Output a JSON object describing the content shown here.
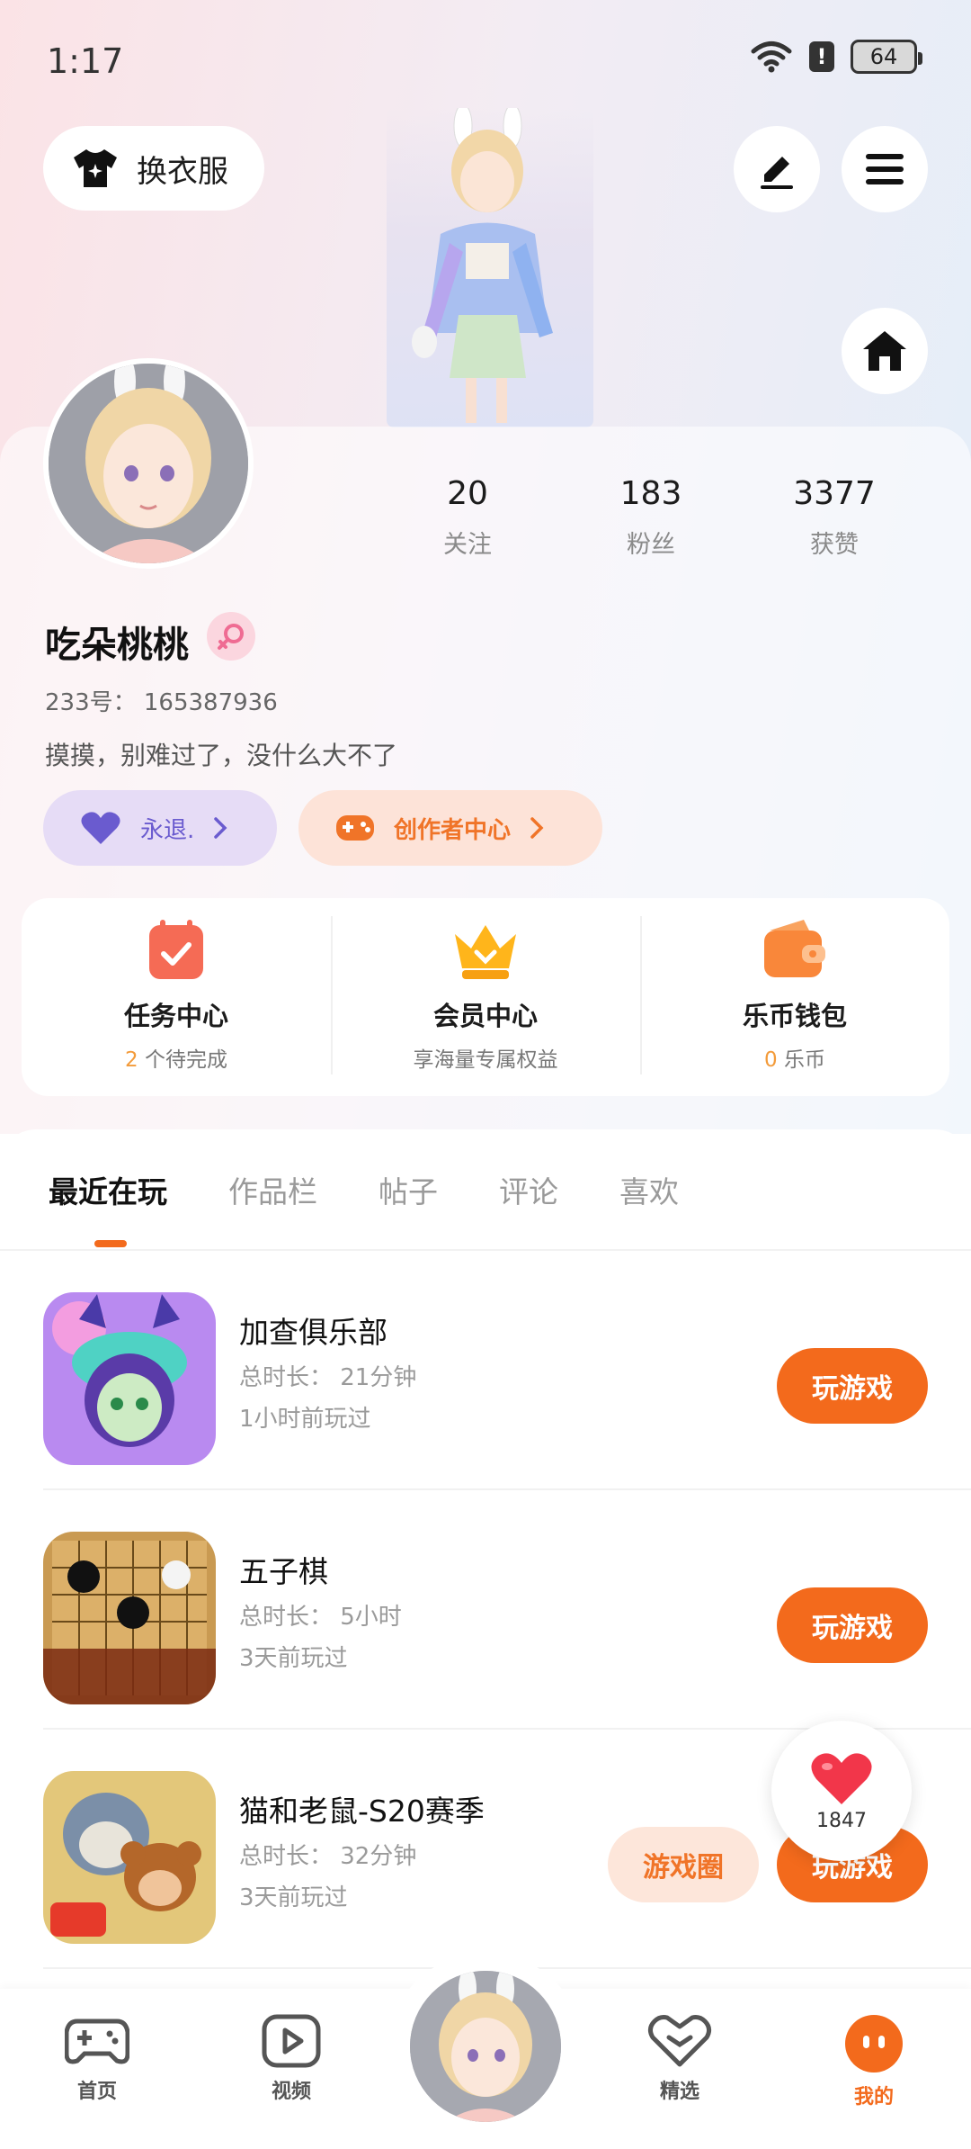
{
  "status_bar": {
    "time": "1:17",
    "battery": "64"
  },
  "header": {
    "outfit_label": "换衣服"
  },
  "profile": {
    "stats": [
      {
        "value": "20",
        "label": "关注"
      },
      {
        "value": "183",
        "label": "粉丝"
      },
      {
        "value": "3377",
        "label": "获赞"
      }
    ],
    "username": "吃朵桃桃",
    "uid": "233号： 165387936",
    "bio": "摸摸，别难过了，没什么大不了",
    "fan_pill": "永退.",
    "creator_pill": "创作者中心"
  },
  "quick": [
    {
      "title": "任务中心",
      "highlight": "2",
      "sub": " 个待完成"
    },
    {
      "title": "会员中心",
      "highlight": "",
      "sub": "享海量专属权益"
    },
    {
      "title": "乐币钱包",
      "highlight": "0",
      "sub": " 乐币"
    }
  ],
  "tabs": [
    "最近在玩",
    "作品栏",
    "帖子",
    "评论",
    "喜欢"
  ],
  "games": [
    {
      "name": "加查俱乐部",
      "duration": "总时长： 21分钟",
      "last": "1小时前玩过",
      "play": "玩游戏"
    },
    {
      "name": "五子棋",
      "duration": "总时长： 5小时",
      "last": "3天前玩过",
      "play": "玩游戏"
    },
    {
      "name": "猫和老鼠-S20赛季",
      "duration": "总时长： 32分钟",
      "last": "3天前玩过",
      "play": "玩游戏",
      "circle": "游戏圈"
    }
  ],
  "like_float": {
    "count": "1847"
  },
  "bottom_nav": {
    "items": [
      {
        "label": "首页"
      },
      {
        "label": "视频"
      },
      {
        "label": "精选"
      },
      {
        "label": "我的"
      }
    ]
  },
  "colors": {
    "accent": "#f36a1c",
    "purple": "#6a5bcf"
  }
}
